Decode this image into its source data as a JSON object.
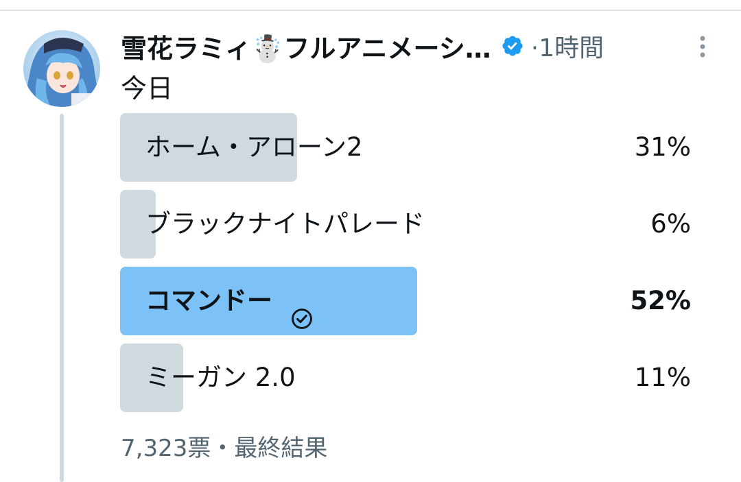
{
  "tweet": {
    "display_name": "雪花ラミィ☃️フルアニメーシ…",
    "time": "·1時間",
    "text": "今日"
  },
  "poll": {
    "options": [
      {
        "label": "ホーム・アローン2",
        "percent_label": "31%",
        "percent": 31,
        "winner": false
      },
      {
        "label": "ブラックナイトパレード",
        "percent_label": "6%",
        "percent": 6,
        "winner": false
      },
      {
        "label": "コマンドー",
        "percent_label": "52%",
        "percent": 52,
        "winner": true
      },
      {
        "label": "ミーガン 2.0",
        "percent_label": "11%",
        "percent": 11,
        "winner": false
      }
    ],
    "footer": "7,323票・最終結果"
  },
  "icons": {
    "verified": "verified-badge-icon",
    "more": "more-options-icon",
    "winner_check": "check-circle-icon"
  },
  "colors": {
    "verified_blue": "#1d9bf0",
    "winner_fill": "#7cc2f6",
    "option_fill": "#cfd9de",
    "secondary_text": "#536471"
  }
}
